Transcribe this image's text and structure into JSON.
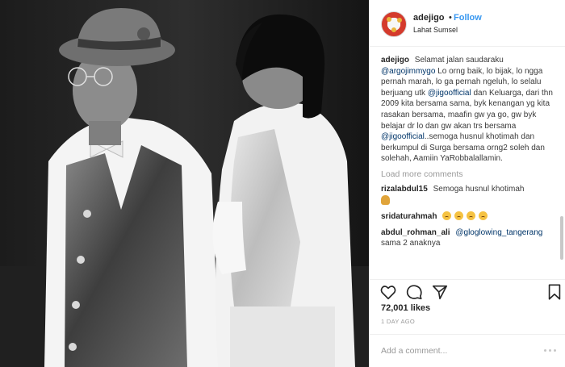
{
  "header": {
    "username": "adejigo",
    "separator": "•",
    "follow_label": "Follow",
    "location": "Lahat Sumsel"
  },
  "caption": {
    "username": "adejigo",
    "text_1": "Selamat jalan saudaraku",
    "mention_1": "@argojimmygo",
    "text_2": "Lo orng baik, lo bijak, lo ngga pernah marah, lo ga pernah ngeluh, lo selalu berjuang utk",
    "mention_2": "@jigoofficial",
    "text_3": "dan Keluarga, dari thn 2009 kita bersama sama, byk kenangan yg kita rasakan bersama, maafin gw ya go, gw byk belajar dr lo dan gw akan trs bersama",
    "mention_3": "@jigoofficial",
    "text_4": "..semoga husnul khotimah dan berkumpul di Surga bersama orng2 soleh dan solehah, Aamiin YaRobbalallamin."
  },
  "load_more_label": "Load more comments",
  "comments": [
    {
      "username": "rizalabdul15",
      "text": "Semoga husnul khotimah"
    },
    {
      "username": "sridaturahmah",
      "text": ""
    },
    {
      "username": "abdul_rohman_ali",
      "mention": "@gloglowing_tangerang",
      "text": "sama 2 anaknya"
    }
  ],
  "icons": {
    "like": "heart-icon",
    "comment": "comment-icon",
    "share": "share-icon",
    "save": "bookmark-icon",
    "more": "more-dots-icon"
  },
  "likes_label": "72,001 likes",
  "time_ago": "1 DAY AGO",
  "add_comment_placeholder": "Add a comment...",
  "colors": {
    "link_blue": "#3897f0",
    "mention_blue": "#003569",
    "muted_gray": "#999999",
    "text_dark": "#262626"
  }
}
